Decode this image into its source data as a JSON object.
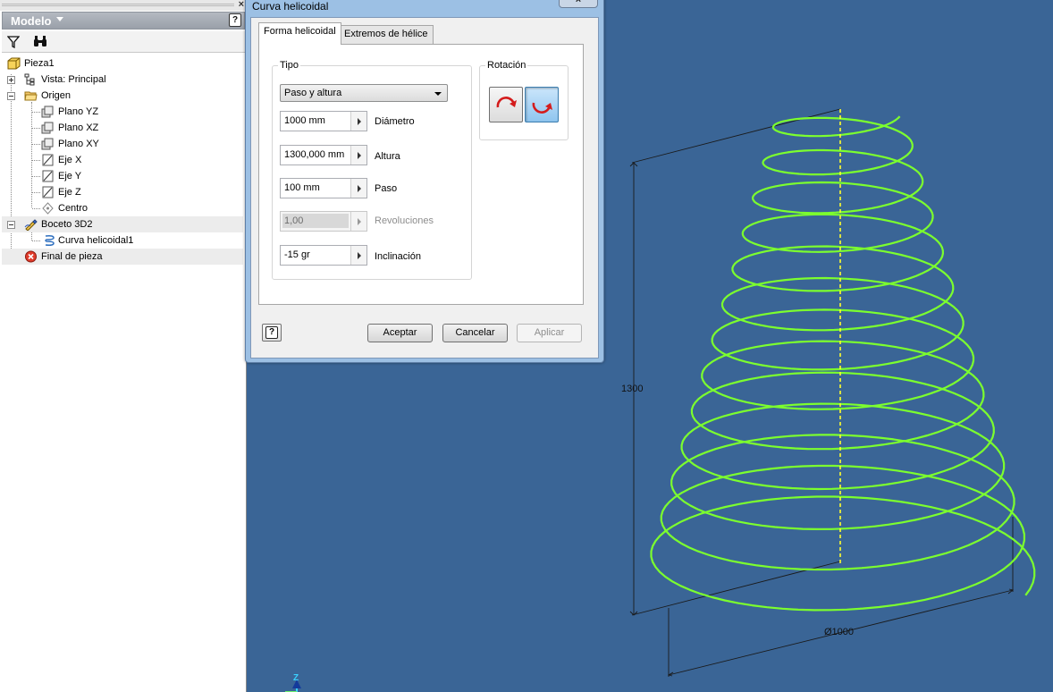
{
  "browser": {
    "title": "Modelo",
    "close_glyph": "×",
    "help_glyph": "?",
    "tree": {
      "part": "Pieza1",
      "view": "Vista: Principal",
      "origin": "Origen",
      "origin_items": [
        "Plano YZ",
        "Plano XZ",
        "Plano XY",
        "Eje X",
        "Eje Y",
        "Eje Z",
        "Centro"
      ],
      "sketch": "Boceto 3D2",
      "sketch_child": "Curva helicoidal1",
      "end": "Final de pieza"
    }
  },
  "dialog": {
    "title": "Curva helicoidal",
    "close_glyph": "×",
    "tabs": [
      "Forma helicoidal",
      "Extremos de hélice"
    ],
    "tipo": {
      "label": "Tipo",
      "selected": "Paso y altura"
    },
    "fields": [
      {
        "value": "1000 mm",
        "label": "Diámetro",
        "disabled": false
      },
      {
        "value": "1300,000 mm",
        "label": "Altura",
        "disabled": false
      },
      {
        "value": "100 mm",
        "label": "Paso",
        "disabled": false
      },
      {
        "value": "1,00",
        "label": "Revoluciones",
        "disabled": true
      },
      {
        "value": "-15 gr",
        "label": "Inclinación",
        "disabled": false
      }
    ],
    "rotation": {
      "label": "Rotación",
      "selected": "left"
    },
    "buttons": {
      "help": "?",
      "ok": "Aceptar",
      "cancel": "Cancelar",
      "apply": "Aplicar"
    }
  },
  "viewport": {
    "background": "#3a6596",
    "helix_color": "#7cff2e",
    "axis_color": "#ffff2e",
    "dimension_height": "1300",
    "dimension_diameter": "Ø1000",
    "triad_axis": "Z"
  }
}
